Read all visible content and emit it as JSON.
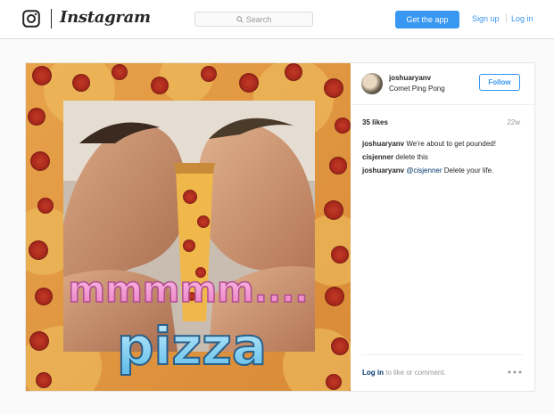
{
  "nav": {
    "wordmark": "Instagram",
    "search_placeholder": "Search",
    "get_app_label": "Get the app",
    "signup_label": "Sign up",
    "login_label": "Log in"
  },
  "post": {
    "image_text_top": "mmmmm....",
    "image_text_bottom": "pizza",
    "username": "joshuaryanv",
    "location": "Comet Ping Pong",
    "follow_label": "Follow",
    "likes": "35 likes",
    "age": "22w",
    "comments": [
      {
        "user": "joshuaryanv",
        "mention": "",
        "text": "We're about to get pounded!"
      },
      {
        "user": "cisjenner",
        "mention": "",
        "text": "delete this"
      },
      {
        "user": "joshuaryanv",
        "mention": "@cisjenner",
        "text": "Delete your life."
      }
    ],
    "login_prompt_link": "Log in",
    "login_prompt_text": "to like or comment."
  },
  "colors": {
    "accent": "#3897f0",
    "text": "#262626",
    "muted": "#999999",
    "link_dark": "#003569",
    "pizza_sauce": "#c8402a",
    "pepperoni": "#a8281c",
    "cheese": "#f0b84a",
    "pink_text": "#f29ad0",
    "blue_text": "#7fd0f0"
  },
  "icons": {
    "logo": "instagram-camera-icon",
    "search": "magnifier-icon",
    "more": "ellipsis-icon"
  }
}
